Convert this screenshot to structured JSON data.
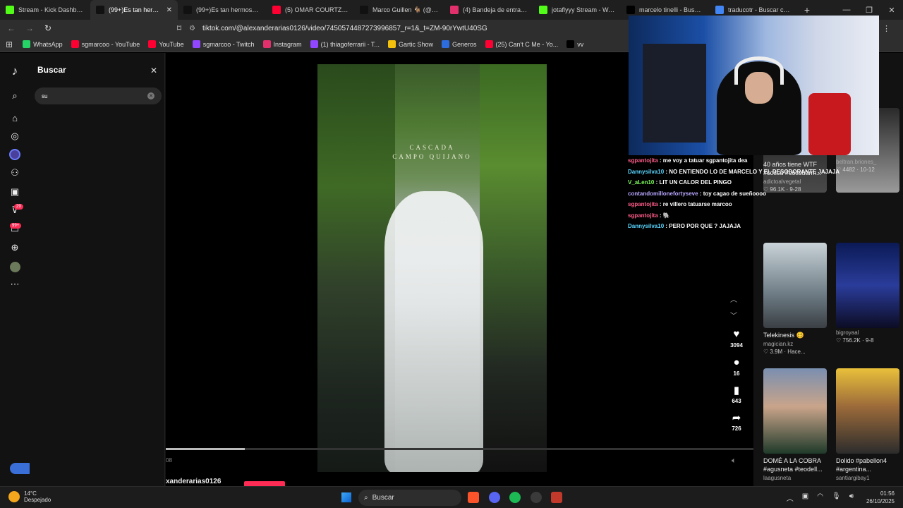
{
  "browser": {
    "tabs": [
      {
        "label": "Stream - Kick Dashboard",
        "fav": "#53fc18"
      },
      {
        "label": "(99+)Es tan hermosa",
        "fav": "#111111",
        "active": true
      },
      {
        "label": "(99+)Es tan hermosa, que",
        "fav": "#111111"
      },
      {
        "label": "(5) OMAR COURTZ - LUCE",
        "fav": "#ff0033"
      },
      {
        "label": "Marco Guillen 🐐 (@sgma",
        "fav": "#111111"
      },
      {
        "label": "(4) Bandeja de entrada • C",
        "fav": "#e1306c"
      },
      {
        "label": "jotaflyyy Stream - Watch l",
        "fav": "#53fc18"
      },
      {
        "label": "marcelo tinelli - Buscar / X",
        "fav": "#000000"
      },
      {
        "label": "traducotr - Buscar con Go",
        "fav": "#4285f4"
      }
    ],
    "url": "tiktok.com/@alexanderarias0126/video/7450574487273996857_r=1&_t=ZM-90rYwtU40SG",
    "bookmarks": [
      {
        "label": "WhatsApp",
        "fav": "#25d366"
      },
      {
        "label": "sgmarcoo - YouTube",
        "fav": "#ff0033"
      },
      {
        "label": "YouTube",
        "fav": "#ff0033"
      },
      {
        "label": "sgmarcoo - Twitch",
        "fav": "#9146ff"
      },
      {
        "label": "Instagram",
        "fav": "#e1306c"
      },
      {
        "label": "(1) thiagoferrarii - T...",
        "fav": "#9146ff"
      },
      {
        "label": "Gartic Show",
        "fav": "#f4c20d"
      },
      {
        "label": "Generos",
        "fav": "#2d6cdf"
      },
      {
        "label": "(25) Can't C Me - Yo...",
        "fav": "#ff0033"
      },
      {
        "label": "vv",
        "fav": "#000000"
      }
    ]
  },
  "search": {
    "title": "Buscar",
    "value": "su"
  },
  "rail": {
    "badge_inbox": "29",
    "badge_messages": "99+"
  },
  "video": {
    "title_line1": "CASCADA",
    "title_line2": "CAMPO QUIJANO",
    "progress": 0.135,
    "time": "08",
    "author": "xanderarias0126",
    "likes": "3094",
    "comments": "16",
    "saves": "643",
    "shares": "726"
  },
  "suggested": [
    {
      "title": "40 años tiene WTF",
      "title2": "#coscu #coscuarm...",
      "author": "adictoalvegetal",
      "stats": "♡ 96.1K · 9-28",
      "col": 0,
      "row": 0,
      "thumb": "linear-gradient(180deg,#222,#555)"
    },
    {
      "title": "",
      "title2": "",
      "author": "beltran.briones_",
      "stats": "♡ 4482 · 10-12",
      "col": 1,
      "row": 0,
      "thumb": "linear-gradient(180deg,#333,#888)"
    },
    {
      "title": "Telekinesis 🥴",
      "title2": "",
      "author": "magician.kz",
      "stats": "♡ 3.9M · Hace...",
      "col": 0,
      "row": 1,
      "thumb": "linear-gradient(180deg,#c9d3d8,#6e7c85 60%,#3a3f44)"
    },
    {
      "title": "",
      "title2": "",
      "author": "bigroyaal",
      "stats": "♡ 756.2K · 9-8",
      "col": 1,
      "row": 1,
      "thumb": "linear-gradient(180deg,#0b1a55,#2a3c9a 50%,#0c0c24)"
    },
    {
      "title": "DOMÉ A LA COBRA",
      "title2": "#agusneta #teodell...",
      "author": "laagusneta",
      "stats": "",
      "col": 0,
      "row": 2,
      "thumb": "linear-gradient(180deg,#7a8fb0,#c9a48a 45%,#1f3a2a)"
    },
    {
      "title": "Dolido #pabellon4",
      "title2": "#argentina...",
      "author": "santiargibay1",
      "stats": "",
      "col": 1,
      "row": 2,
      "thumb": "linear-gradient(180deg,#e9c03a,#9b6a3a 45%,#2c2c2c)"
    }
  ],
  "chat": [
    {
      "user": "sgpantojita",
      "color": "#ff5c8a",
      "msg": "me voy a tatuar sgpantojita dea"
    },
    {
      "user": "Dannysilva10",
      "color": "#5ad7ff",
      "msg": "NO ENTIENDO LO DE MARCELO Y EL DESODORANTE JAJAJA"
    },
    {
      "user": "V_aLen10",
      "color": "#7cff5a",
      "msg": "LIT UN CALOR DEL PINGO"
    },
    {
      "user": "contandomillonefortyseve",
      "color": "#b9a6ff",
      "msg": "toy cagao de sueñoooo"
    },
    {
      "user": "sgpantojita",
      "color": "#ff5c8a",
      "msg": "re villero tatuarse marcoo"
    },
    {
      "user": "sgpantojita",
      "color": "#ff5c8a",
      "msg": "🐘"
    },
    {
      "user": "Dannysilva10",
      "color": "#5ad7ff",
      "msg": "PERO POR QUE ? JAJAJA"
    }
  ],
  "taskbar": {
    "temp": "14°C",
    "weather": "Despejado",
    "search": "Buscar",
    "time": "01:56",
    "date": "26/10/2025"
  }
}
